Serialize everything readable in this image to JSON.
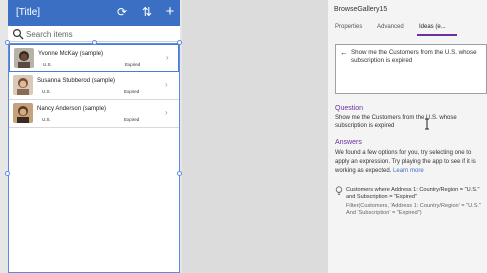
{
  "app": {
    "title": "[Title]",
    "search": {
      "placeholder": "Search items"
    }
  },
  "gallery": {
    "items": [
      {
        "name": "Yvonne McKay (sample)",
        "country": "U.S.",
        "status": "Expired"
      },
      {
        "name": "Susanna Stubberod (sample)",
        "country": "U.S.",
        "status": "Expired"
      },
      {
        "name": "Nancy Anderson (sample)",
        "country": "U.S.",
        "status": "Expired"
      }
    ]
  },
  "panel": {
    "title": "BrowseGallery15",
    "tabs": [
      "Properties",
      "Advanced",
      "Ideas (e..."
    ],
    "query": "Show me the Customers from the U.S. whose subscription is expired",
    "question": {
      "heading": "Question",
      "text": "Show me the Customers from the U.S. whose subscription is expired"
    },
    "answers": {
      "heading": "Answers",
      "text": "We found a few options for you, try selecting one to apply an expression. Try playing the app to see if it is working as expected.",
      "link": "Learn more"
    },
    "suggestion": {
      "description": "Customers where Address 1: Country/Region = \"U.S.\" and Subscription = \"Expired\"",
      "formula": "Filter(Customers, 'Address 1: Country/Region' = \"U.S.\" And 'Subscription' = \"Expired\")"
    }
  },
  "colors": {
    "header": "#3b6fc4",
    "accent": "#6b2fa0",
    "selection": "#5c8be0"
  }
}
